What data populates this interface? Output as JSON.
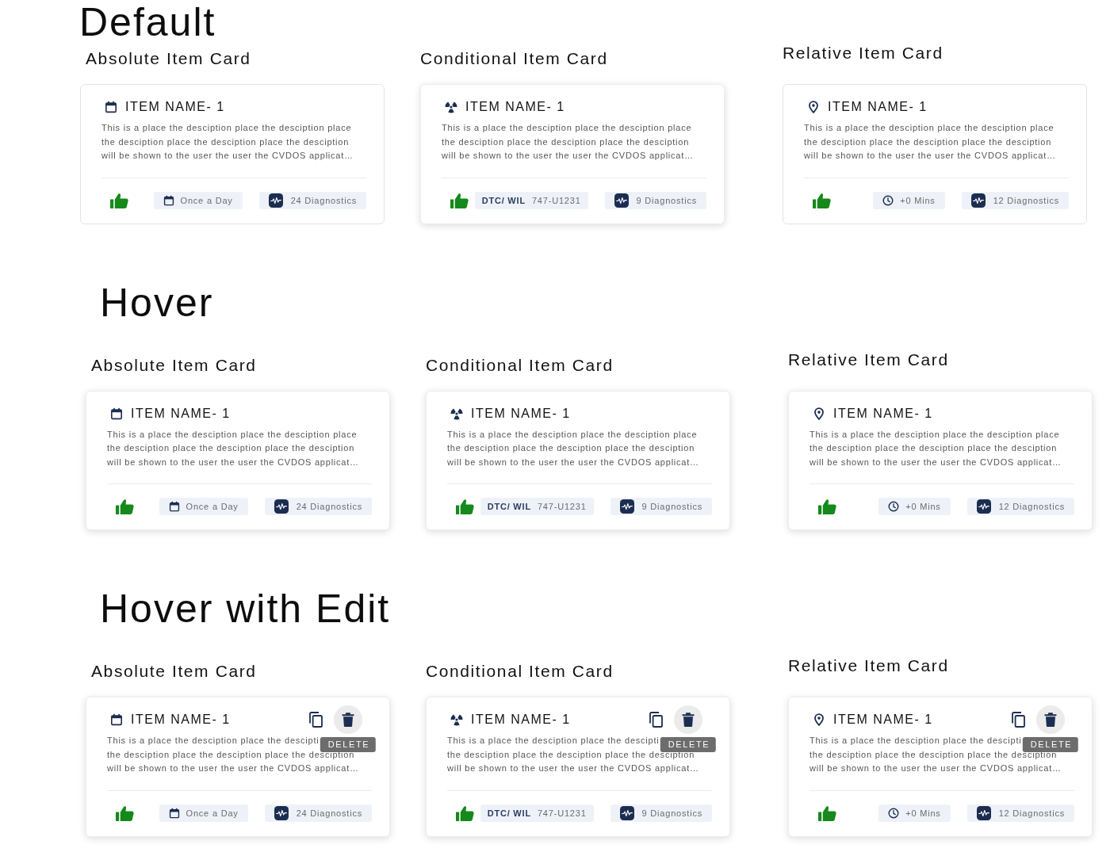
{
  "sections": [
    {
      "title": "Default",
      "cards": [
        {
          "label": "Absolute Item Card",
          "kind": "absolute",
          "name": "ITEM NAME- 1",
          "description": [
            "This is a place the desciption place the desciption place the desciption place the desciption place the desciption will be shown to the user the user the CVDOS applicat…"
          ],
          "hovered": false,
          "edit_actions": false,
          "liked": true,
          "chips": [
            {
              "kind": "schedule",
              "text": "Once a Day"
            },
            {
              "kind": "diagnostics",
              "text": "24 Diagnostics"
            }
          ]
        },
        {
          "label": "Conditional Item Card",
          "kind": "conditional",
          "name": "ITEM NAME- 1",
          "description": [
            "This is a place the desciption place the desciption place the desciption place the desciption place the desciption will be shown to the user the user the CVDOS applicat…"
          ],
          "hovered": true,
          "edit_actions": false,
          "liked": true,
          "chips": [
            {
              "kind": "code",
              "label": "DTC/ WIL",
              "value": "747-U1231"
            },
            {
              "kind": "diagnostics",
              "text": "9 Diagnostics"
            }
          ]
        },
        {
          "label": "Relative Item Card",
          "kind": "relative",
          "name": "ITEM NAME- 1",
          "description": [
            "This is a place the desciption place the desciption place the desciption place the desciption place the desciption will be shown to the user the user the CVDOS applicat…"
          ],
          "hovered": false,
          "edit_actions": false,
          "liked": true,
          "chips": [
            {
              "kind": "duration",
              "text": "+0 Mins"
            },
            {
              "kind": "diagnostics",
              "text": "12 Diagnostics"
            }
          ]
        }
      ]
    },
    {
      "title": "Hover",
      "cards": [
        {
          "label": "Absolute Item Card",
          "kind": "absolute",
          "name": "ITEM NAME- 1",
          "description": [
            "This is a place the desciption place the desciption place the desciption place the desciption place the desciption will be shown to the user the user the CVDOS applicat…"
          ],
          "hovered": true,
          "edit_actions": false,
          "liked": true,
          "chips": [
            {
              "kind": "schedule",
              "text": "Once a Day"
            },
            {
              "kind": "diagnostics",
              "text": "24 Diagnostics"
            }
          ]
        },
        {
          "label": "Conditional Item Card",
          "kind": "conditional",
          "name": "ITEM NAME- 1",
          "description": [
            "This is a place the desciption place the desciption place the desciption place the desciption place the desciption will be shown to the user the user the CVDOS applicat…"
          ],
          "hovered": true,
          "edit_actions": false,
          "liked": true,
          "chips": [
            {
              "kind": "code",
              "label": "DTC/ WIL",
              "value": "747-U1231"
            },
            {
              "kind": "diagnostics",
              "text": "9 Diagnostics"
            }
          ]
        },
        {
          "label": "Relative Item Card",
          "kind": "relative",
          "name": "ITEM NAME- 1",
          "description": [
            "This is a place the desciption place the desciption place the desciption place the desciption place the desciption will be shown to the user the user the CVDOS applicat…"
          ],
          "hovered": true,
          "edit_actions": false,
          "liked": true,
          "chips": [
            {
              "kind": "duration",
              "text": "+0 Mins"
            },
            {
              "kind": "diagnostics",
              "text": "12 Diagnostics"
            }
          ]
        }
      ]
    },
    {
      "title": "Hover with Edit",
      "cards": [
        {
          "label": "Absolute Item Card",
          "kind": "absolute",
          "name": "ITEM NAME- 1",
          "description": [
            "This is a place the desciption place the descipti",
            "the desciption place the desciption place the desciption will be shown to the user the user the CVDOS applicat…"
          ],
          "hovered": true,
          "edit_actions": true,
          "tooltip": "DELETE",
          "liked": true,
          "chips": [
            {
              "kind": "schedule",
              "text": "Once a Day"
            },
            {
              "kind": "diagnostics",
              "text": "24 Diagnostics"
            }
          ]
        },
        {
          "label": "Conditional Item Card",
          "kind": "conditional",
          "name": "ITEM NAME- 1",
          "description": [
            "This is a place the desciption place the descipti",
            "the desciption place the desciption place the desciption will be shown to the user the user the CVDOS applicat…"
          ],
          "hovered": true,
          "edit_actions": true,
          "tooltip": "DELETE",
          "liked": true,
          "chips": [
            {
              "kind": "code",
              "label": "DTC/ WIL",
              "value": "747-U1231"
            },
            {
              "kind": "diagnostics",
              "text": "9 Diagnostics"
            }
          ]
        },
        {
          "label": "Relative Item Card",
          "kind": "relative",
          "name": "ITEM NAME- 1",
          "description": [
            "This is a place the desciption place the descipti",
            "the desciption place the desciption place the desciption will be shown to the user the user the CVDOS applicat…"
          ],
          "hovered": true,
          "edit_actions": true,
          "tooltip": "DELETE",
          "liked": true,
          "chips": [
            {
              "kind": "duration",
              "text": "+0 Mins"
            },
            {
              "kind": "diagnostics",
              "text": "12 Diagnostics"
            }
          ]
        }
      ]
    }
  ]
}
